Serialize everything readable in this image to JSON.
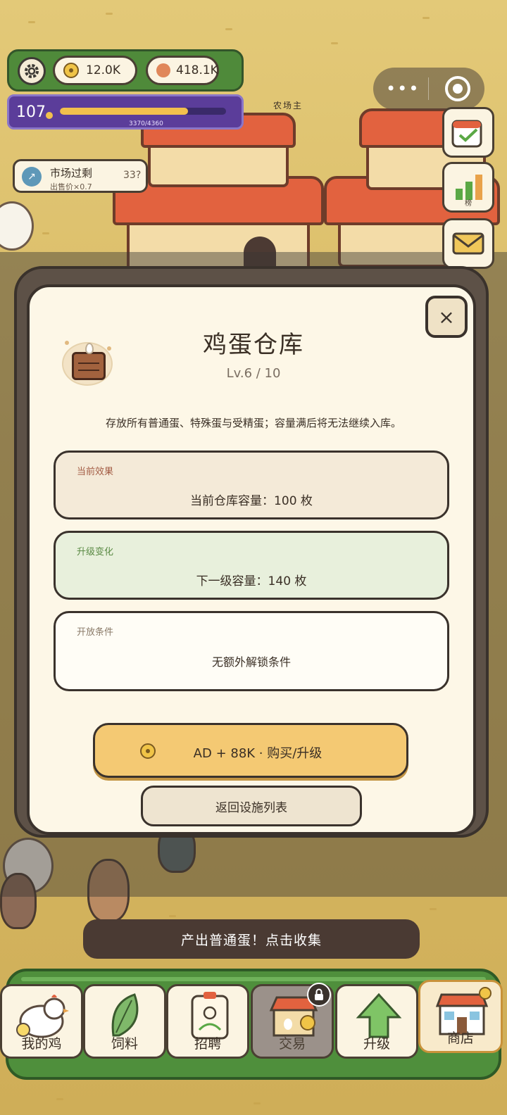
{
  "hud": {
    "coins": "12.0K",
    "bronze": "418.1K",
    "level": "107",
    "level_title": "农场主",
    "xp_text": "3370/4360",
    "xp_progress": 0.773
  },
  "market": {
    "title": "市场过剩",
    "subtitle": "出售价×0.7",
    "timer": "33?"
  },
  "side": {
    "leaderboard_label": "榜"
  },
  "modal": {
    "title": "鸡蛋仓库",
    "level_text": "Lv.6 / 10",
    "description": "存放所有普通蛋、特殊蛋与受精蛋；容量满后将无法继续入库。",
    "close_label": "×",
    "cards": [
      {
        "title": "当前效果",
        "body": "当前仓库容量：100 枚"
      },
      {
        "title": "升级变化",
        "body": "下一级容量：140 枚"
      },
      {
        "title": "开放条件",
        "body": "无额外解锁条件"
      }
    ],
    "upgrade_button": "AD + 88K · 购买/升级",
    "back_button": "返回设施列表"
  },
  "toast": "产出普通蛋！点击收集",
  "nav": {
    "tabs": [
      "我的鸡",
      "饲料",
      "招聘",
      "交易",
      "升级",
      "商店"
    ]
  },
  "colors": {
    "accent": "#f4c973",
    "hud_green": "#4f8a3a",
    "modal_bg": "#fdf7e7"
  }
}
